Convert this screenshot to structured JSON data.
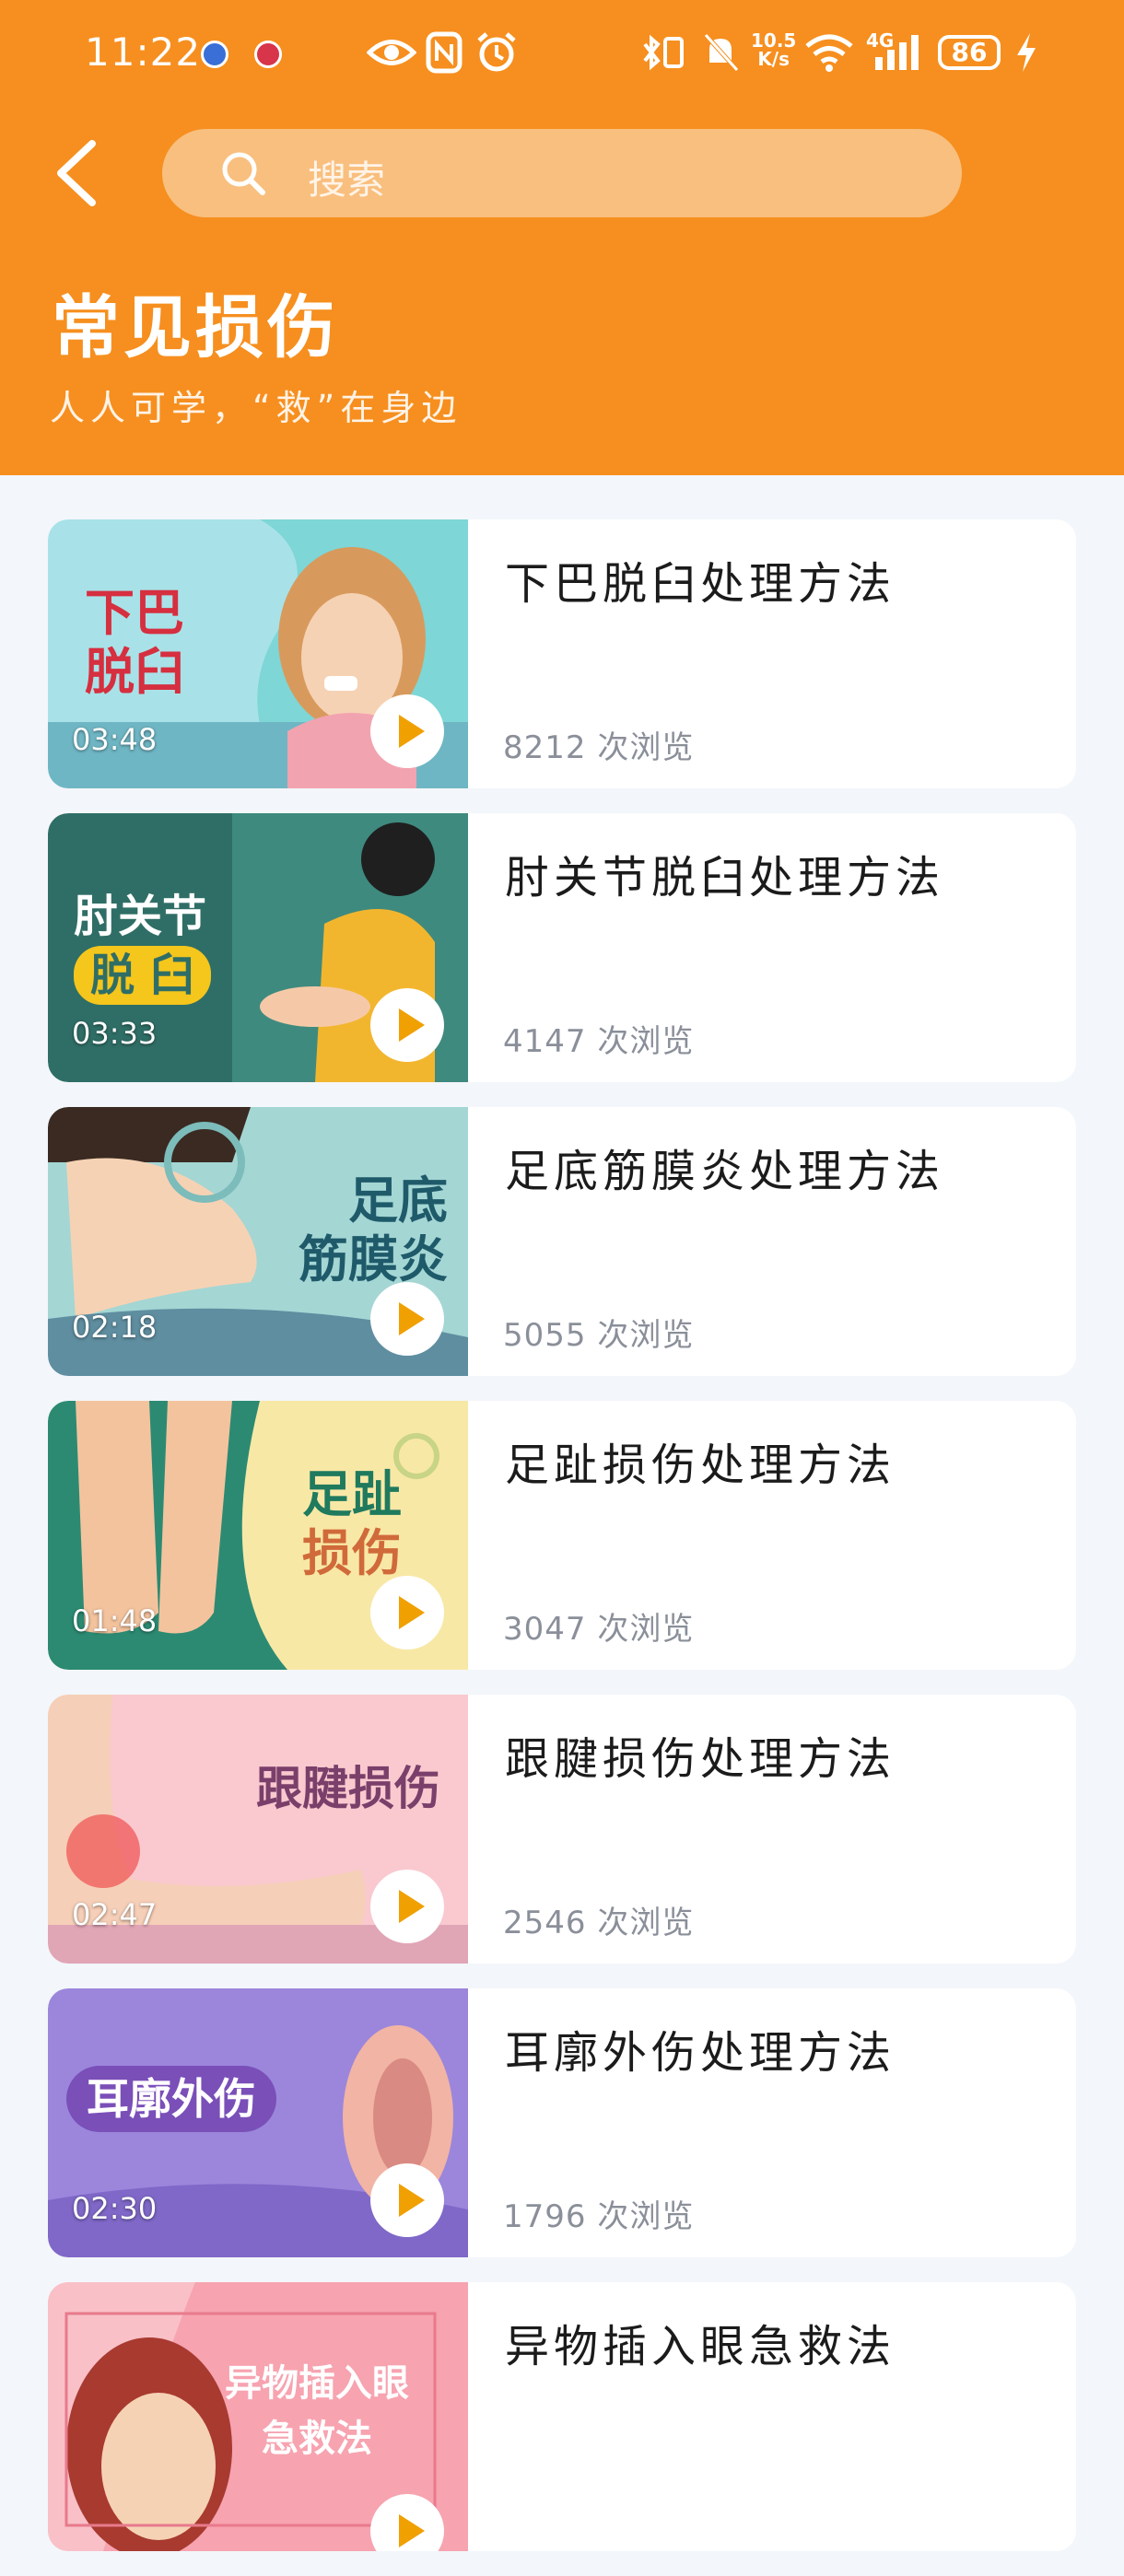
{
  "status_bar": {
    "time": "11:22",
    "net_speed_value": "10.5",
    "net_speed_unit": "K/s",
    "signal_label": "4G",
    "battery": "86"
  },
  "search": {
    "placeholder": "搜索"
  },
  "page": {
    "title": "常见损伤",
    "subtitle": "人人可学，“救”在身边"
  },
  "colors": {
    "header": "#f68f1f",
    "search_bg": "#f9bf7e",
    "background": "#f3f6fa"
  },
  "videos": [
    {
      "title": "下巴脱臼处理方法",
      "views": "8212 次浏览",
      "duration": "03:48",
      "thumb_text": [
        "下巴",
        "脱臼"
      ]
    },
    {
      "title": "肘关节脱臼处理方法",
      "views": "4147 次浏览",
      "duration": "03:33",
      "thumb_text": [
        "肘关节",
        "脱 臼"
      ]
    },
    {
      "title": "足底筋膜炎处理方法",
      "views": "5055 次浏览",
      "duration": "02:18",
      "thumb_text": [
        "足底",
        "筋膜炎"
      ]
    },
    {
      "title": "足趾损伤处理方法",
      "views": "3047 次浏览",
      "duration": "01:48",
      "thumb_text": [
        "足趾",
        "损伤"
      ]
    },
    {
      "title": "跟腱损伤处理方法",
      "views": "2546 次浏览",
      "duration": "02:47",
      "thumb_text": [
        "跟腱损伤"
      ]
    },
    {
      "title": "耳廓外伤处理方法",
      "views": "1796 次浏览",
      "duration": "02:30",
      "thumb_text": [
        "耳廓外伤"
      ]
    },
    {
      "title": "异物插入眼急救法",
      "views": "",
      "duration": "",
      "thumb_text": [
        "异物插入眼",
        "急救法"
      ]
    }
  ]
}
